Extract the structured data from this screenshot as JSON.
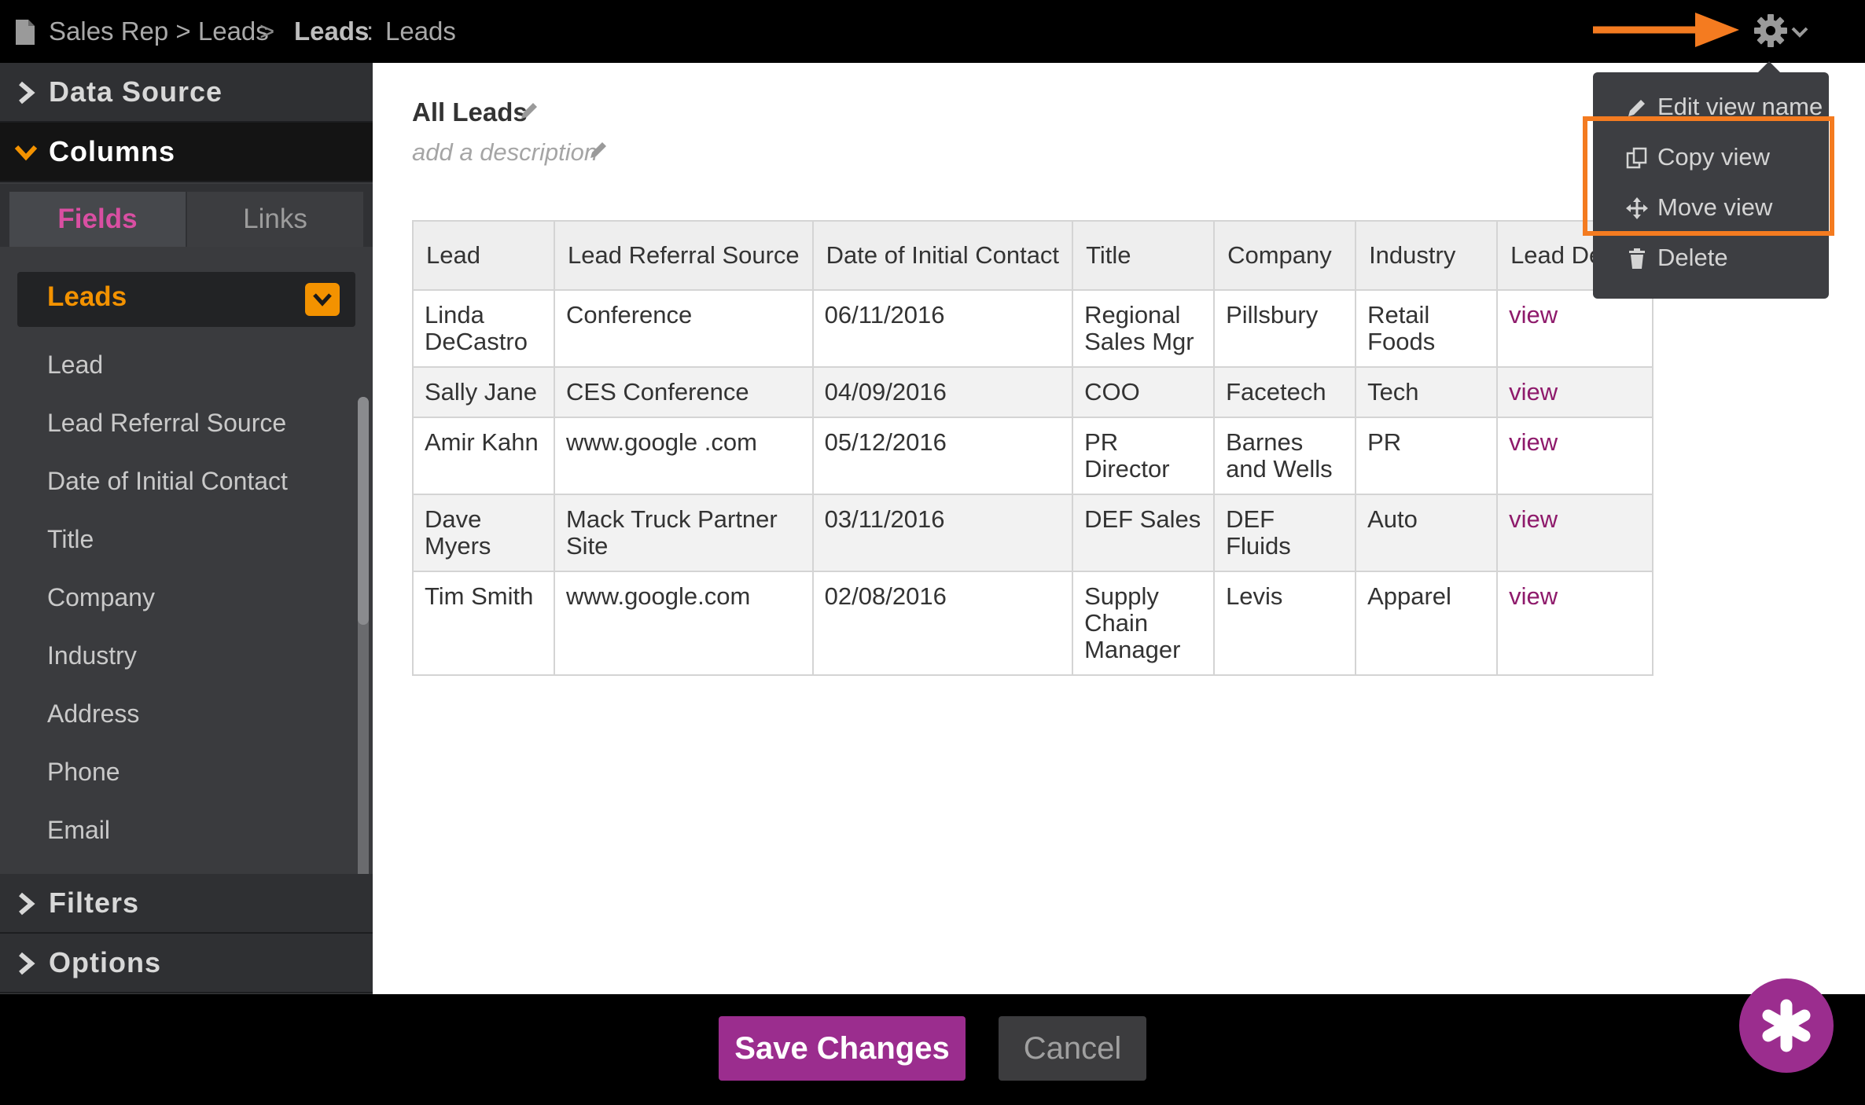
{
  "breadcrumb": {
    "path": "Sales Rep > Leads",
    "separator": ">",
    "current": "Leads",
    "colon": ":",
    "view_name": "Leads"
  },
  "sidebar": {
    "sections": {
      "data_source": "Data Source",
      "columns": "Columns",
      "filters": "Filters",
      "options": "Options"
    },
    "tabs": {
      "fields": "Fields",
      "links": "Links"
    },
    "object_select": "Leads",
    "fields": [
      "Lead",
      "Lead Referral Source",
      "Date of Initial Contact",
      "Title",
      "Company",
      "Industry",
      "Address",
      "Phone",
      "Email"
    ]
  },
  "view": {
    "title": "All Leads",
    "description_placeholder": "add a description"
  },
  "table": {
    "headers": [
      "Lead",
      "Lead Referral Source",
      "Date of Initial Contact",
      "Title",
      "Company",
      "Industry",
      "Lead Deta"
    ],
    "rows": [
      {
        "lead": "Linda DeCastro",
        "source": "Conference",
        "date": "06/11/2016",
        "title": "Regional Sales Mgr",
        "company": "Pillsbury",
        "industry": "Retail Foods",
        "details": "view"
      },
      {
        "lead": "Sally Jane",
        "source": "CES Conference",
        "date": "04/09/2016",
        "title": "COO",
        "company": "Facetech",
        "industry": "Tech",
        "details": "view"
      },
      {
        "lead": "Amir Kahn",
        "source": "www.google .com",
        "date": "05/12/2016",
        "title": "PR Director",
        "company": "Barnes and Wells",
        "industry": "PR",
        "details": "view"
      },
      {
        "lead": "Dave Myers",
        "source": "Mack Truck Partner Site",
        "date": "03/11/2016",
        "title": "DEF Sales",
        "company": "DEF Fluids",
        "industry": "Auto",
        "details": "view"
      },
      {
        "lead": "Tim Smith",
        "source": "www.google.com",
        "date": "02/08/2016",
        "title": "Supply Chain Manager",
        "company": "Levis",
        "industry": "Apparel",
        "details": "view"
      }
    ]
  },
  "settings_menu": {
    "items": [
      {
        "label": "Edit view name",
        "icon": "pencil-icon"
      },
      {
        "label": "Copy view",
        "icon": "copy-icon"
      },
      {
        "label": "Move view",
        "icon": "move-icon"
      },
      {
        "label": "Delete",
        "icon": "trash-icon"
      }
    ]
  },
  "footer": {
    "save_label": "Save Changes",
    "cancel_label": "Cancel"
  },
  "colors": {
    "accent_orange": "#f39200",
    "annotation_orange": "#f47b20",
    "brand_purple": "#9b2d8e",
    "link_purple": "#8e1a6b",
    "tab_active_pink": "#d94fa2"
  }
}
